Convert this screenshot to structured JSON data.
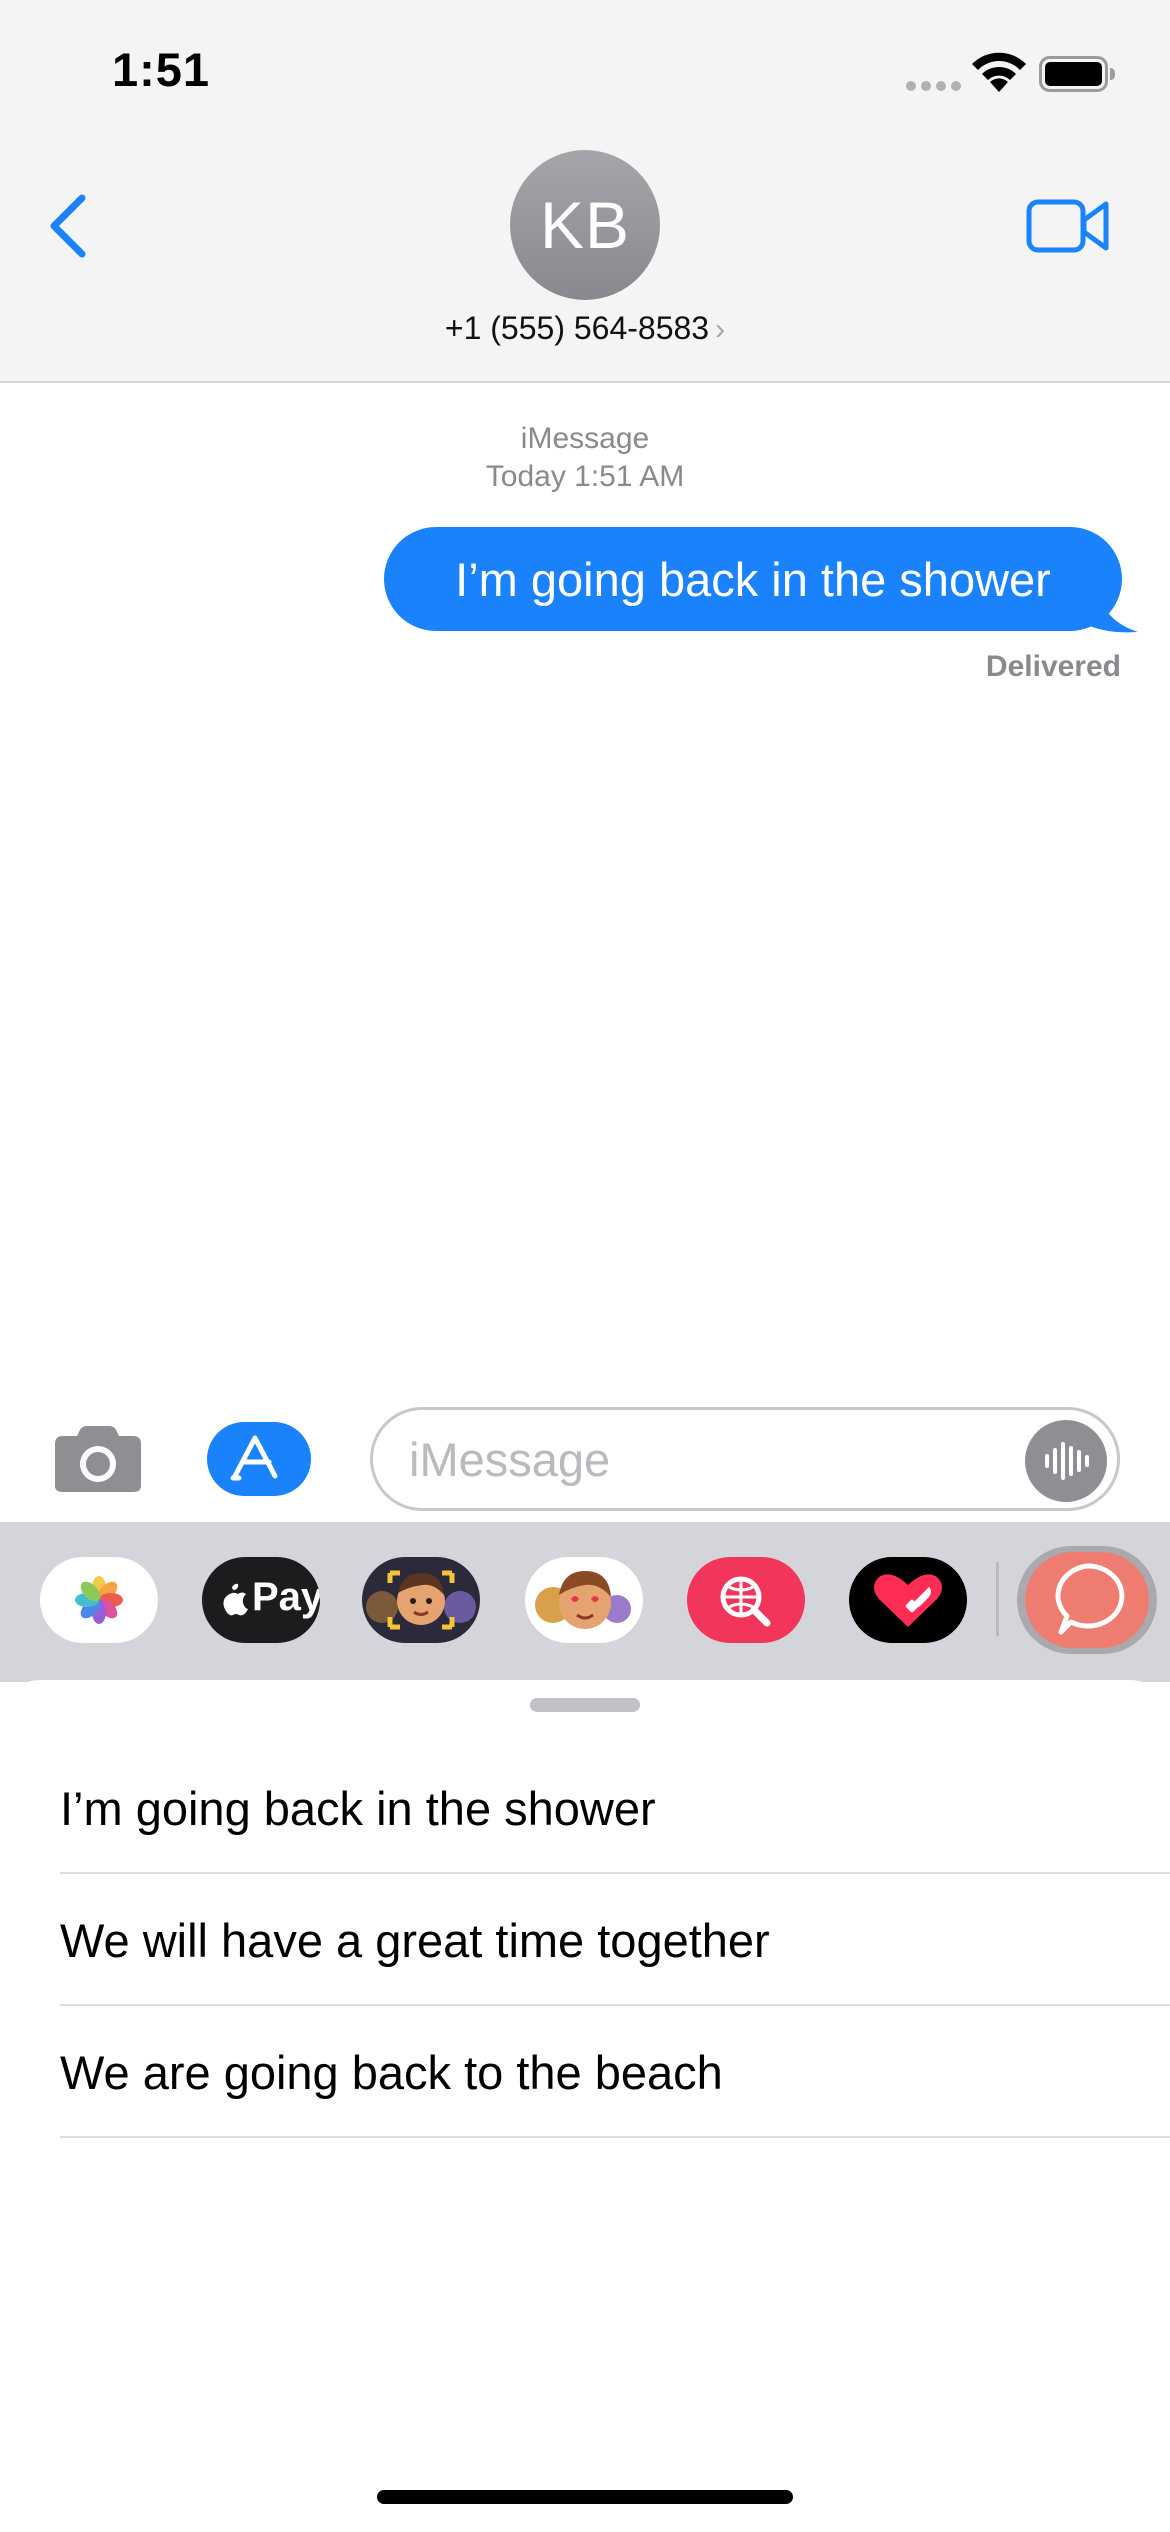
{
  "status_bar": {
    "time": "1:51"
  },
  "header": {
    "avatar_initials": "KB",
    "contact": "+1 (555) 564-8583",
    "contact_chevron": "›",
    "back_icon": "chevron-left-icon",
    "video_icon": "video-camera-icon"
  },
  "conversation": {
    "service": "iMessage",
    "timestamp": "Today 1:51 AM",
    "messages": [
      {
        "text": "I’m going back in the shower",
        "sender": "me",
        "status": "Delivered"
      }
    ]
  },
  "input_bar": {
    "placeholder": "iMessage",
    "value": "",
    "camera_icon": "camera-icon",
    "apps_icon": "app-store-icon",
    "audio_icon": "waveform-icon"
  },
  "app_drawer": {
    "apps": [
      {
        "name": "Photos",
        "icon": "photos-icon"
      },
      {
        "name": "Apple Pay",
        "label": "Pay",
        "icon": "apple-pay-icon"
      },
      {
        "name": "Memoji",
        "icon": "memoji-camera-icon"
      },
      {
        "name": "Memoji Stickers",
        "icon": "memoji-stickers-icon"
      },
      {
        "name": "Images",
        "icon": "globe-search-icon"
      },
      {
        "name": "Digital Touch",
        "icon": "digital-touch-heart-icon"
      },
      {
        "name": "Selected App",
        "icon": "speech-bubble-icon"
      }
    ]
  },
  "suggestions": {
    "items": [
      "I’m going back in the shower",
      "We will have a great time together",
      "We are going back to the beach"
    ]
  },
  "colors": {
    "accent": "#1a82fb",
    "header_bg": "#f4f4f5",
    "drawer_bg": "#d4d5da",
    "secondary_text": "#8a8a8e"
  }
}
